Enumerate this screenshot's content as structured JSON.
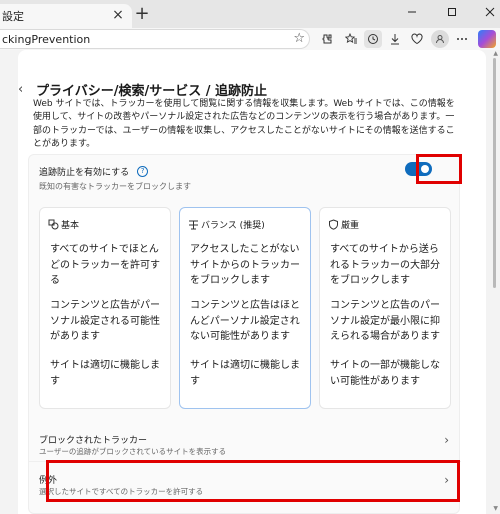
{
  "browser": {
    "tab_title": "設定",
    "url_text": "ckingPrevention"
  },
  "page": {
    "title": "プライバシー/検索/サービス / 追跡防止",
    "description": "Web サイトでは、トラッカーを使用して閲覧に関する情報を収集します。Web サイトでは、この情報を使用して、サイトの改善やパーソナル設定された広告などのコンテンツの表示を行う場合があります。一部のトラッカーでは、ユーザーの情報を収集し、アクセスしたことがないサイトにその情報を送信することがあります。"
  },
  "tracking_toggle": {
    "label": "追跡防止を有効にする",
    "sublabel": "既知の有害なトラッカーをブロックします",
    "enabled": true
  },
  "options": [
    {
      "name": "基本",
      "paragraphs": [
        "すべてのサイトでほとんどのトラッカーを許可する",
        "コンテンツと広告がパーソナル設定される可能性があります",
        "サイトは適切に機能します"
      ],
      "selected": false
    },
    {
      "name": "バランス (推奨)",
      "paragraphs": [
        "アクセスしたことがないサイトからのトラッカーをブロックします",
        "コンテンツと広告はほとんどパーソナル設定されない可能性があります",
        "サイトは適切に機能します"
      ],
      "selected": true
    },
    {
      "name": "厳重",
      "paragraphs": [
        "すべてのサイトから送られるトラッカーの大部分をブロックします",
        "コンテンツと広告のパーソナル設定が最小限に抑えられる場合があります",
        "サイトの一部が機能しない可能性があります"
      ],
      "selected": false
    }
  ],
  "rows": {
    "blocked": {
      "title": "ブロックされたトラッカー",
      "subtitle": "ユーザーの追跡がブロックされているサイトを表示する"
    },
    "exceptions": {
      "title": "例外",
      "subtitle": "選択したサイトですべてのトラッカーを許可する"
    }
  },
  "colors": {
    "accent": "#0f6cbd",
    "highlight": "#e00000"
  }
}
